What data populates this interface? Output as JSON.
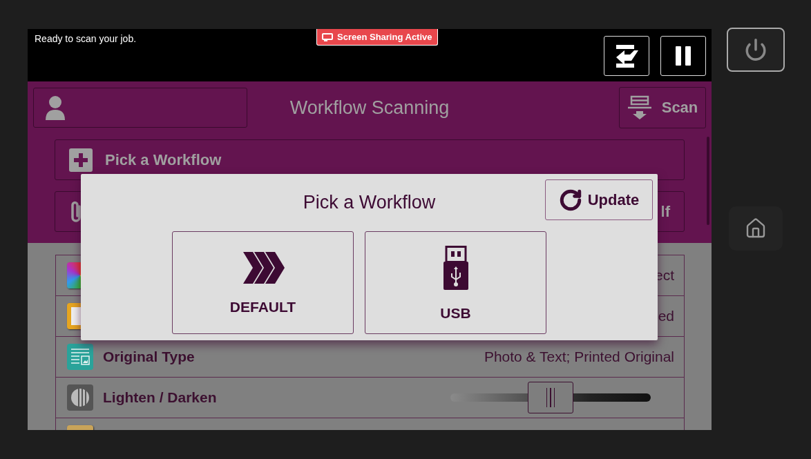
{
  "status_bar": {
    "message": "Ready to scan your job.",
    "sharing_badge": "Screen Sharing Active"
  },
  "app_bar": {
    "title": "Workflow Scanning",
    "scan_button": "Scan"
  },
  "feature_rows": [
    {
      "kind": "pick",
      "label": "Pick a Workflow"
    },
    {
      "kind": "attach",
      "value": "lf"
    }
  ],
  "settings": [
    {
      "kind": "value",
      "value": "ect"
    },
    {
      "kind": "value",
      "value": "ed"
    },
    {
      "kind": "value",
      "label": "Original Type",
      "value": "Photo & Text; Printed Original"
    },
    {
      "kind": "slider",
      "label": "Lighten / Darken",
      "level": 0.5
    },
    {
      "kind": "value"
    }
  ],
  "dialog": {
    "title": "Pick a Workflow",
    "update_button": "Update",
    "options": [
      {
        "kind": "default",
        "label": "DEFAULT"
      },
      {
        "kind": "usb",
        "label": "USB"
      }
    ]
  }
}
